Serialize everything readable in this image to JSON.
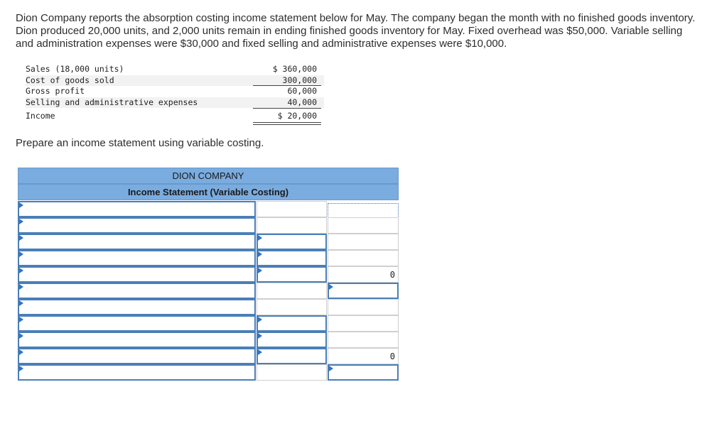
{
  "problem": {
    "text": "Dion Company reports the absorption costing income statement below for May. The company began the month with no finished goods inventory. Dion produced 20,000 units, and 2,000 units remain in ending finished goods inventory for May. Fixed overhead was $50,000. Variable selling and administration expenses were $30,000 and fixed selling and administrative expenses were $10,000."
  },
  "absorption_statement": {
    "rows": [
      {
        "label": "Sales (18,000 units)",
        "amount": "$ 360,000"
      },
      {
        "label": "Cost of goods sold",
        "amount": "300,000"
      },
      {
        "label": "Gross profit",
        "amount": "60,000"
      },
      {
        "label": "Selling and administrative expenses",
        "amount": "40,000"
      },
      {
        "label": "Income",
        "amount": "$ 20,000"
      }
    ]
  },
  "instruction": "Prepare an income statement using variable costing.",
  "worksheet": {
    "company": "DION COMPANY",
    "title": "Income Statement (Variable Costing)",
    "totals": [
      "0",
      "0"
    ]
  },
  "colors": {
    "header_bg": "#7aace0",
    "input_border": "#4a7fb8",
    "marker": "#2f73c9"
  }
}
